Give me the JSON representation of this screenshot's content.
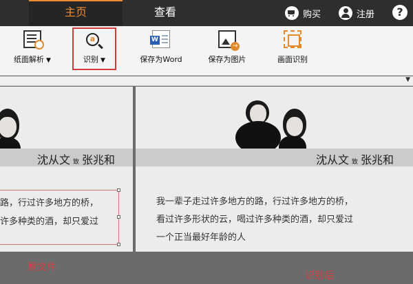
{
  "nav": {
    "tabs": [
      {
        "label": "主页",
        "active": true
      },
      {
        "label": "查看",
        "active": false
      }
    ],
    "buy_label": "购买",
    "register_label": "注册",
    "help_label": "?"
  },
  "toolbar": {
    "items": [
      {
        "label": "纸面解析",
        "icon": "page-analysis-icon",
        "dropdown": true
      },
      {
        "label": "识别",
        "icon": "recognize-icon",
        "dropdown": true,
        "highlighted": true
      },
      {
        "label": "保存为Word",
        "icon": "save-word-icon",
        "dropdown": false
      },
      {
        "label": "保存为图片",
        "icon": "save-image-icon",
        "dropdown": false
      },
      {
        "label": "画面识别",
        "icon": "screen-recognize-icon",
        "dropdown": false
      }
    ],
    "recognize_glyph": "a",
    "caret": "▼"
  },
  "left_pane": {
    "names": {
      "from": "沈从文",
      "connector": "致",
      "to": "张兆和"
    },
    "lines": [
      "路，行过许多地方的桥，",
      "许多种类的酒，却只爱过"
    ],
    "caption": "原文件"
  },
  "right_pane": {
    "names": {
      "from": "沈从文",
      "connector": "致",
      "to": "张兆和"
    },
    "lines": [
      "我一辈子走过许多地方的路，行过许多地方的桥，",
      "看过许多形状的云，喝过许多种类的酒，却只爱过",
      "一个正当最好年龄的人"
    ],
    "caption": "识别后"
  },
  "colors": {
    "accent": "#f08c30",
    "highlight_border": "#d43a3a",
    "caption": "#d14040"
  }
}
